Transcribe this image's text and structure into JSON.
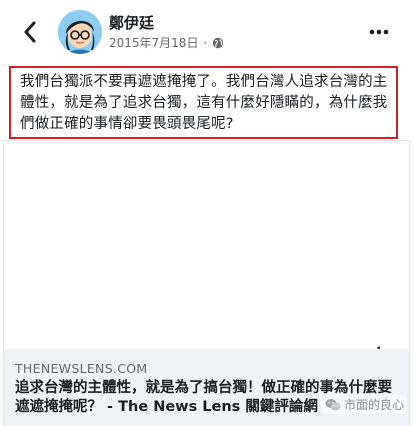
{
  "header": {
    "author_name": "鄭伊廷",
    "date": "2015年7月18日",
    "separator": "·",
    "privacy_icon": "globe-icon",
    "back_icon": "chevron-left-icon",
    "more_icon": "ellipsis-icon"
  },
  "post": {
    "text": "我們台獨派不要再遮遮掩掩了。我們台灣人追求台灣的主體性，就是為了追求台獨，這有什麼好隱瞞的，為什麼我們做正確的事情卻要畏頭畏尾呢?",
    "highlight_color": "#d0212b"
  },
  "link_card": {
    "info_label": "i",
    "domain": "THENEWSLENS.COM",
    "title": "追求台灣的主體性，就是為了搞台獨！做正確的事為什麼要遮遮掩掩呢？ - The News Lens 關鍵評論網"
  },
  "watermark": {
    "text": "市面的良心",
    "icon": "wechat-icon"
  },
  "colors": {
    "text_primary": "#1c1e21",
    "text_secondary": "#65676b",
    "card_footer_bg": "#f0f2f5"
  }
}
